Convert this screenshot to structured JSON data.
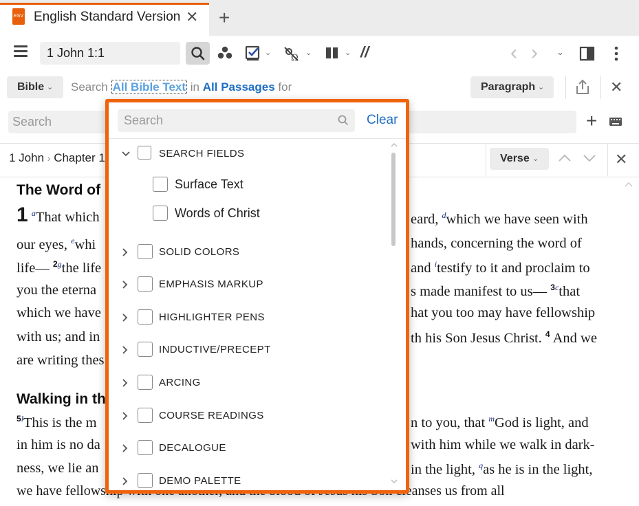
{
  "tab": {
    "title": "English Standard Version",
    "logo_text": "ESV",
    "close": "✕",
    "add": "+"
  },
  "toolbar": {
    "reference": "1 John 1:1",
    "back": "‹",
    "forward": "›",
    "caret": "⌄",
    "parallel_symbol": "//"
  },
  "search_row": {
    "scope_label": "Bible",
    "sentence": {
      "search": "Search",
      "field_link": "All Bible Text",
      "in": "in",
      "passage_link": "All Passages",
      "for": "for"
    },
    "view_label": "Paragraph",
    "input_placeholder": "Search",
    "close": "✕",
    "add": "+"
  },
  "nav_row": {
    "crumbs": [
      "1 John",
      "Chapter 1"
    ],
    "separator": "›",
    "verse_label": "Verse",
    "close": "✕"
  },
  "bible_text": {
    "heading1": "The Word of Life",
    "chapter_num": "1",
    "heading2": "Walking in the Light",
    "lines_left": [
      {
        "pre": "",
        "sup": "a",
        "text": "That which"
      },
      {
        "text": "our eyes, ",
        "sup": "e",
        "after": "whi"
      },
      {
        "text": "life— ",
        "vn": "2",
        "sup": "g",
        "after": "the life"
      },
      {
        "text": "you  the  eterna"
      },
      {
        "text": "which we have"
      },
      {
        "text": "with us; and in"
      },
      {
        "text": "are writing thes"
      }
    ],
    "lines_right": [
      {
        "text": "eard, ",
        "sup": "d",
        "after": "which we have seen with"
      },
      {
        "text": "hands, concerning the word of"
      },
      {
        "text": "and ",
        "sup": "i",
        "after": "testify to it and proclaim to"
      },
      {
        "text": "s  made  manifest  to  us— ",
        "vn": "3",
        "sup": "c",
        "after": "that"
      },
      {
        "text": "hat you too may have fellowship"
      },
      {
        "text": "th his Son Jesus Christ. ",
        "vn": "4",
        "after": " And we"
      }
    ],
    "lines2_left": [
      {
        "vn": "5",
        "sup": "l",
        "text": "This is the m"
      },
      {
        "text": "in  him  is  no  da"
      },
      {
        "text": "ness, we lie an"
      },
      {
        "text": "we  have  fellowship  with  one  another,  and  the  blood  of  Jesus  his  Son  cleanses  us  from  all"
      }
    ],
    "lines2_right": [
      {
        "text": "n  to  you,  that ",
        "sup": "m",
        "after": "God  is  light,  and"
      },
      {
        "text": "with him while we walk in dark-"
      },
      {
        "text": "in the light, ",
        "sup": "q",
        "after": "as he is in the light,"
      }
    ]
  },
  "popup": {
    "search_placeholder": "Search",
    "clear_label": "Clear",
    "sections": [
      {
        "label": "SEARCH FIELDS",
        "expanded": true,
        "children": [
          "Surface Text",
          "Words of Christ"
        ]
      },
      {
        "label": "SOLID COLORS",
        "expanded": false
      },
      {
        "label": "EMPHASIS MARKUP",
        "expanded": false
      },
      {
        "label": "HIGHLIGHTER PENS",
        "expanded": false
      },
      {
        "label": "INDUCTIVE/PRECEPT",
        "expanded": false
      },
      {
        "label": "ARCING",
        "expanded": false
      },
      {
        "label": "COURSE READINGS",
        "expanded": false
      },
      {
        "label": "DECALOGUE",
        "expanded": false
      },
      {
        "label": "DEMO PALETTE",
        "expanded": false
      }
    ]
  },
  "colors": {
    "accent": "#f0630c",
    "link": "#1f6fc2",
    "verse_sup": "#1a2b80"
  }
}
